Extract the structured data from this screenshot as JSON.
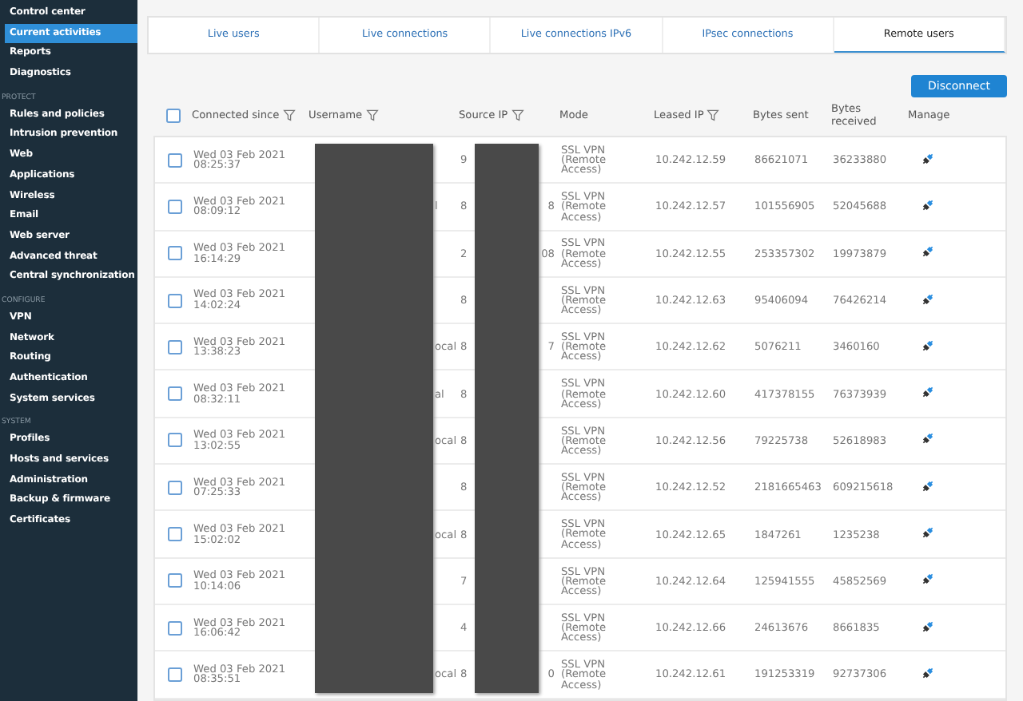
{
  "sidebar": {
    "items": [
      {
        "label": "Control center",
        "selected": false
      },
      {
        "label": "Current activities",
        "selected": true
      },
      {
        "label": "Reports",
        "selected": false
      },
      {
        "label": "Diagnostics",
        "selected": false
      }
    ],
    "sections": [
      {
        "heading": "PROTECT",
        "items": [
          "Rules and policies",
          "Intrusion prevention",
          "Web",
          "Applications",
          "Wireless",
          "Email",
          "Web server",
          "Advanced threat",
          "Central synchronization"
        ]
      },
      {
        "heading": "CONFIGURE",
        "items": [
          "VPN",
          "Network",
          "Routing",
          "Authentication",
          "System services"
        ]
      },
      {
        "heading": "SYSTEM",
        "items": [
          "Profiles",
          "Hosts and services",
          "Administration",
          "Backup & firmware",
          "Certificates"
        ]
      }
    ]
  },
  "tabs": [
    {
      "label": "Live users",
      "selected": false
    },
    {
      "label": "Live connections",
      "selected": false
    },
    {
      "label": "Live connections IPv6",
      "selected": false
    },
    {
      "label": "IPsec connections",
      "selected": false
    },
    {
      "label": "Remote users",
      "selected": true
    }
  ],
  "disconnect_button": "Disconnect",
  "select_all": {
    "checked": false
  },
  "table": {
    "columns": [
      {
        "label": "Connected since",
        "filter": true
      },
      {
        "label": "Username",
        "filter": true
      },
      {
        "label": "Source IP",
        "filter": true
      },
      {
        "label": "Mode",
        "filter": false
      },
      {
        "label": "Leased IP",
        "filter": true
      },
      {
        "label": "Bytes sent",
        "filter": false
      },
      {
        "label": "Bytes received",
        "filter": false
      },
      {
        "label": "Manage",
        "filter": false
      }
    ],
    "rows": [
      {
        "checked": false,
        "date": "Wed 03 Feb 2021",
        "time": "08:25:37",
        "ip_head": "9",
        "mode": "SSL VPN (Remote Access)",
        "leased_ip": "10.242.12.59",
        "sent": "86621071",
        "received": "36233880"
      },
      {
        "checked": false,
        "date": "Wed 03 Feb 2021",
        "time": "08:09:12",
        "user_tail": "l",
        "ip_head": "8",
        "ip_tail": "8",
        "mode": "SSL VPN (Remote Access)",
        "leased_ip": "10.242.12.57",
        "sent": "101556905",
        "received": "52045688"
      },
      {
        "checked": false,
        "date": "Wed 03 Feb 2021",
        "time": "16:14:29",
        "ip_head": "2",
        "ip_tail": "08",
        "mode": "SSL VPN (Remote Access)",
        "leased_ip": "10.242.12.55",
        "sent": "253357302",
        "received": "19973879"
      },
      {
        "checked": false,
        "date": "Wed 03 Feb 2021",
        "time": "14:02:24",
        "ip_head": "8",
        "mode": "SSL VPN (Remote Access)",
        "leased_ip": "10.242.12.63",
        "sent": "95406094",
        "received": "76426214"
      },
      {
        "checked": false,
        "date": "Wed 03 Feb 2021",
        "time": "13:38:23",
        "user_tail": "ocal",
        "ip_head": "8",
        "ip_tail": "7",
        "mode": "SSL VPN (Remote Access)",
        "leased_ip": "10.242.12.62",
        "sent": "5076211",
        "received": "3460160"
      },
      {
        "checked": false,
        "date": "Wed 03 Feb 2021",
        "time": "08:32:11",
        "user_tail": "al",
        "ip_head": "8",
        "mode": "SSL VPN (Remote Access)",
        "leased_ip": "10.242.12.60",
        "sent": "417378155",
        "received": "76373939"
      },
      {
        "checked": false,
        "date": "Wed 03 Feb 2021",
        "time": "13:02:55",
        "user_tail": "ocal",
        "ip_head": "8",
        "mode": "SSL VPN (Remote Access)",
        "leased_ip": "10.242.12.56",
        "sent": "79225738",
        "received": "52618983"
      },
      {
        "checked": false,
        "date": "Wed 03 Feb 2021",
        "time": "07:25:33",
        "ip_head": "8",
        "mode": "SSL VPN (Remote Access)",
        "leased_ip": "10.242.12.52",
        "sent": "2181665463",
        "received": "609215618"
      },
      {
        "checked": false,
        "date": "Wed 03 Feb 2021",
        "time": "15:02:02",
        "user_tail": "ocal",
        "ip_head": "8",
        "mode": "SSL VPN (Remote Access)",
        "leased_ip": "10.242.12.65",
        "sent": "1847261",
        "received": "1235238"
      },
      {
        "checked": false,
        "date": "Wed 03 Feb 2021",
        "time": "10:14:06",
        "ip_head": "7",
        "mode": "SSL VPN (Remote Access)",
        "leased_ip": "10.242.12.64",
        "sent": "125941555",
        "received": "45852569"
      },
      {
        "checked": false,
        "date": "Wed 03 Feb 2021",
        "time": "16:06:42",
        "ip_head": "4",
        "mode": "SSL VPN (Remote Access)",
        "leased_ip": "10.242.12.66",
        "sent": "24613676",
        "received": "8661835"
      },
      {
        "checked": false,
        "date": "Wed 03 Feb 2021",
        "time": "08:35:51",
        "user_tail": "ocal",
        "ip_head": "8",
        "ip_tail": "0",
        "mode": "SSL VPN (Remote Access)",
        "leased_ip": "10.242.12.61",
        "sent": "191253319",
        "received": "92737306"
      }
    ]
  }
}
